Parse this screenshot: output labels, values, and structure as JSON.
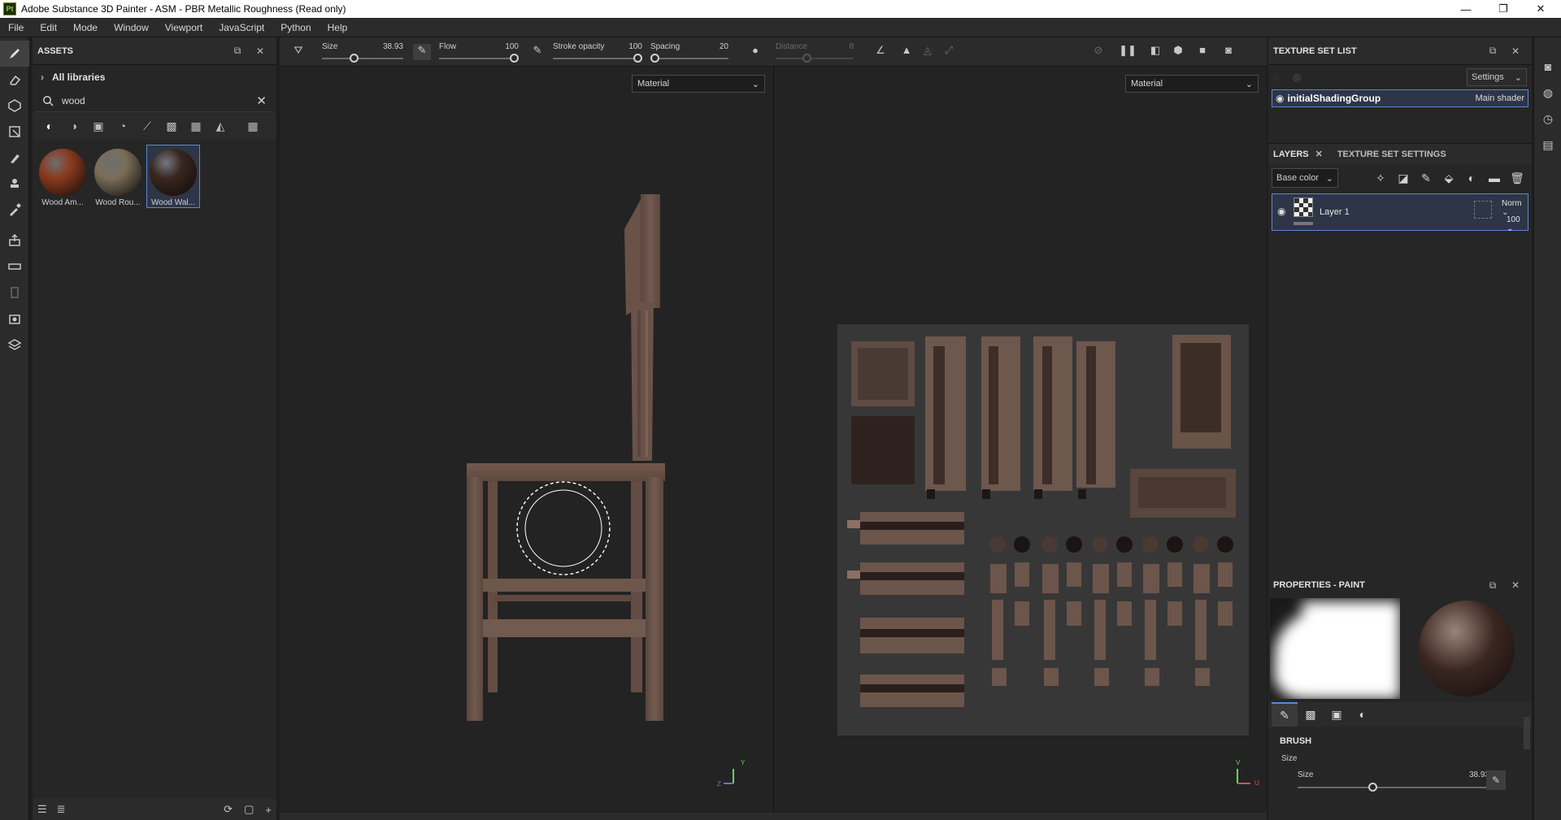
{
  "window": {
    "title": "Adobe Substance 3D Painter - ASM - PBR Metallic Roughness (Read only)",
    "app_icon": "Pt",
    "controls": {
      "minimize": "—",
      "maximize": "❐",
      "close": "✕"
    }
  },
  "menu": [
    "File",
    "Edit",
    "Mode",
    "Window",
    "Viewport",
    "JavaScript",
    "Python",
    "Help"
  ],
  "left_tools": [
    "paint-brush-icon",
    "eraser-icon",
    "projection-icon",
    "geometry-mask-icon",
    "smudge-icon",
    "clone-stamp-icon",
    "color-picker-icon",
    "bake-icon",
    "measure-icon",
    "export-icon",
    "camera-icon",
    "texture-icon",
    "cube-icon"
  ],
  "assets": {
    "title": "ASSETS",
    "library": "All libraries",
    "search_value": "wood",
    "items": [
      {
        "label": "Wood Am...",
        "color": "#8a3a1e"
      },
      {
        "label": "Wood Rou...",
        "color": "#7a6e58"
      },
      {
        "label": "Wood Wal...",
        "color": "#3a2620",
        "selected": true
      }
    ]
  },
  "toolbar": {
    "size": {
      "label": "Size",
      "value": "38.93",
      "level": 0.39
    },
    "flow": {
      "label": "Flow",
      "value": "100",
      "level": 1.0
    },
    "stroke_opacity": {
      "label": "Stroke opacity",
      "value": "100",
      "level": 1.0
    },
    "spacing": {
      "label": "Spacing",
      "value": "20",
      "level": 0.02
    },
    "distance": {
      "label": "Distance",
      "value": "8",
      "level": 0.4
    }
  },
  "viewport": {
    "left_mode": "Material",
    "right_mode": "Material",
    "axis_y": "Y",
    "axis_z": "Z",
    "axis_u": "U",
    "axis_v": "V"
  },
  "texture_set_list": {
    "title": "TEXTURE SET LIST",
    "settings": "Settings",
    "row_name": "initialShadingGroup",
    "row_shader": "Main shader"
  },
  "layers": {
    "tab_layers": "LAYERS",
    "tab_settings": "TEXTURE SET SETTINGS",
    "channel": "Base color",
    "layer_name": "Layer 1",
    "blend_mode": "Norm",
    "opacity": "100"
  },
  "properties": {
    "title": "PROPERTIES - PAINT",
    "section": "BRUSH",
    "sub": "Size",
    "size_label": "Size",
    "size_value": "38.93",
    "size_level": 0.39
  }
}
